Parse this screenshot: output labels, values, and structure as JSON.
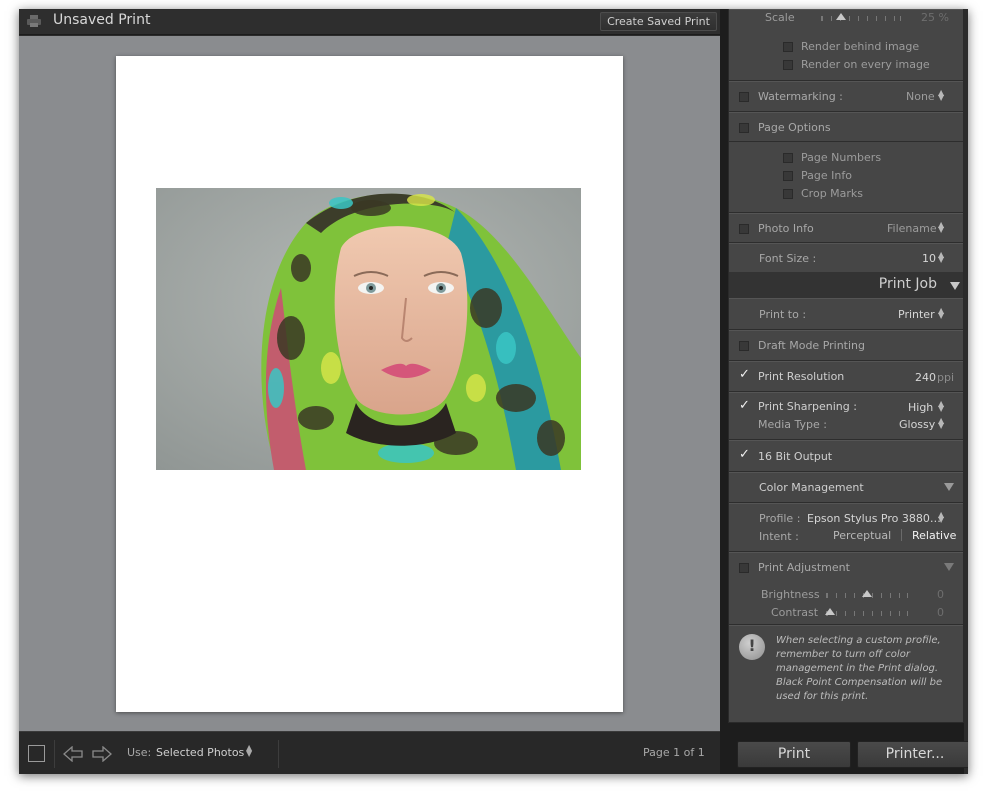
{
  "titlebar": {
    "title": "Unsaved Print",
    "create_button": "Create Saved Print"
  },
  "toolbar": {
    "use_label": "Use:",
    "use_value": "Selected Photos",
    "page_indicator": "Page 1 of 1"
  },
  "panel": {
    "scale": {
      "label": "Scale",
      "value": "25 %",
      "level_fraction": 0.25
    },
    "render_behind": {
      "label": "Render behind image",
      "checked": false
    },
    "render_every": {
      "label": "Render on every image",
      "checked": false
    },
    "watermarking": {
      "label": "Watermarking :",
      "value": "None",
      "checked": false
    },
    "page_options": {
      "label": "Page Options",
      "checked": false,
      "items": [
        {
          "label": "Page Numbers",
          "checked": false
        },
        {
          "label": "Page Info",
          "checked": false
        },
        {
          "label": "Crop Marks",
          "checked": false
        }
      ]
    },
    "photo_info": {
      "label": "Photo Info",
      "value": "Filename",
      "checked": false
    },
    "font_size": {
      "label": "Font Size :",
      "value": "10"
    },
    "print_job": {
      "title": "Print Job",
      "print_to": {
        "label": "Print to :",
        "value": "Printer"
      },
      "draft_mode": {
        "label": "Draft Mode Printing",
        "checked": false
      },
      "resolution": {
        "label": "Print Resolution",
        "value": "240",
        "unit": "ppi",
        "checked": true
      },
      "sharpening": {
        "label": "Print Sharpening :",
        "value": "High",
        "checked": true
      },
      "media_type": {
        "label": "Media Type :",
        "value": "Glossy"
      },
      "bit_output": {
        "label": "16 Bit Output",
        "checked": true
      },
      "color_management": {
        "title": "Color Management",
        "profile_label": "Profile :",
        "profile_value": "Epson Stylus Pro 3880…",
        "intent_label": "Intent :",
        "intent_options": [
          "Perceptual",
          "Relative"
        ],
        "intent_selected": "Relative"
      },
      "print_adjustment": {
        "label": "Print Adjustment",
        "checked": false,
        "brightness": {
          "label": "Brightness",
          "value": "0",
          "level_fraction": 0.5
        },
        "contrast": {
          "label": "Contrast",
          "value": "0",
          "level_fraction": 0.05
        }
      },
      "note": "When selecting a custom profile, remember to turn off color management in the Print dialog. Black Point Compensation will be used for this print."
    }
  },
  "buttons": {
    "print": "Print",
    "printer": "Printer..."
  },
  "colors": {
    "preview_bg": "#8a8c8f",
    "panel_bg": "#464646",
    "frame_bg": "#2b2b2b"
  },
  "icons": [
    "print-icon",
    "arrow-left-icon",
    "arrow-right-icon",
    "exclamation-icon",
    "checkbox-icon",
    "disclosure-triangle-icon",
    "updown-arrows-icon"
  ]
}
